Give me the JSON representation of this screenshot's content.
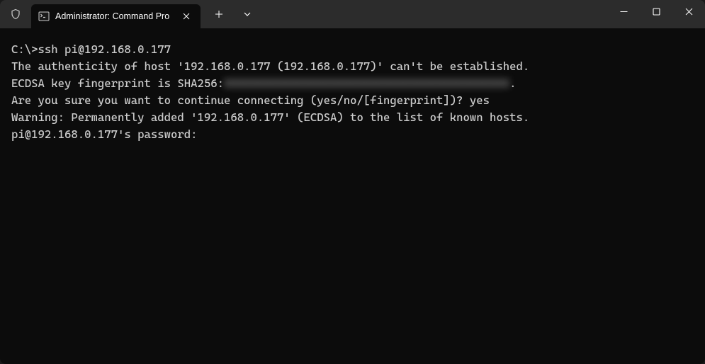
{
  "titlebar": {
    "tab_title": "Administrator: Command Pro",
    "tab_icon": "terminal-icon"
  },
  "terminal": {
    "lines": [
      {
        "prefix": "C:\\>",
        "command": "ssh pi@192.168.0.177"
      },
      {
        "text": "The authenticity of host '192.168.0.177 (192.168.0.177)' can't be established."
      },
      {
        "text_before": "ECDSA key fingerprint is SHA256:",
        "redacted": "XXXXXXXXXXXXXXXXXXXXXXXXXXXXXXXXXXXXXXXXXXX",
        "text_after": "."
      },
      {
        "text": "Are you sure you want to continue connecting (yes/no/[fingerprint])? yes"
      },
      {
        "text": "Warning: Permanently added '192.168.0.177' (ECDSA) to the list of known hosts."
      },
      {
        "text": "pi@192.168.0.177's password:"
      }
    ]
  }
}
